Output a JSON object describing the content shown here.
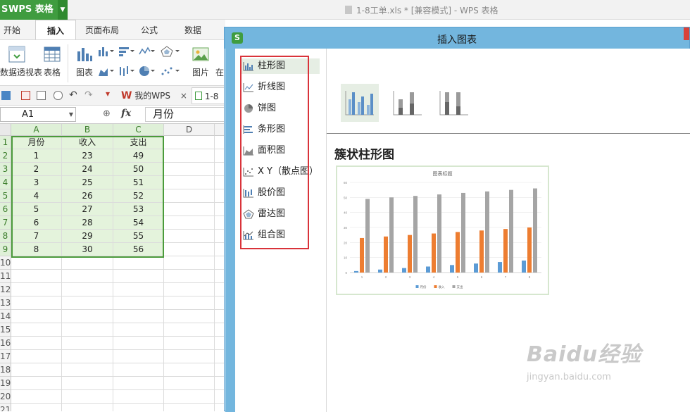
{
  "app": {
    "name": "WPS 表格",
    "logo": "S",
    "window_title": "1-8工单.xls * [兼容模式] - WPS 表格"
  },
  "ribbon": {
    "tabs": [
      "开始",
      "插入",
      "页面布局",
      "公式",
      "数据"
    ],
    "active_tab": "插入",
    "buttons": {
      "pivot": "数据透视表",
      "table": "表格",
      "chart": "图表",
      "picture": "图片",
      "more": "在"
    }
  },
  "quickbar": {
    "wps_tab": "我的WPS",
    "close": "×",
    "doc_tab": "1-8"
  },
  "formula_bar": {
    "cell_ref": "A1",
    "fx": "fx",
    "content": "月份"
  },
  "sheet": {
    "columns": [
      "A",
      "B",
      "C",
      "D"
    ],
    "rows": [
      "1",
      "2",
      "3",
      "4",
      "5",
      "6",
      "7",
      "8",
      "9",
      "10",
      "11",
      "12",
      "13",
      "14",
      "15",
      "16",
      "17",
      "18",
      "19",
      "20",
      "21"
    ],
    "header": [
      "月份",
      "收入",
      "支出"
    ],
    "data": [
      [
        "1",
        "23",
        "49"
      ],
      [
        "2",
        "24",
        "50"
      ],
      [
        "3",
        "25",
        "51"
      ],
      [
        "4",
        "26",
        "52"
      ],
      [
        "5",
        "27",
        "53"
      ],
      [
        "6",
        "28",
        "54"
      ],
      [
        "7",
        "29",
        "55"
      ],
      [
        "8",
        "30",
        "56"
      ]
    ]
  },
  "dialog": {
    "title": "插入图表",
    "icon": "S",
    "chart_types": [
      {
        "label": "柱形图",
        "icon": "column-chart-icon"
      },
      {
        "label": "折线图",
        "icon": "line-chart-icon"
      },
      {
        "label": "饼图",
        "icon": "pie-chart-icon"
      },
      {
        "label": "条形图",
        "icon": "bar-chart-icon"
      },
      {
        "label": "面积图",
        "icon": "area-chart-icon"
      },
      {
        "label": "X Y（散点图）",
        "icon": "scatter-chart-icon"
      },
      {
        "label": "股价图",
        "icon": "stock-chart-icon"
      },
      {
        "label": "雷达图",
        "icon": "radar-chart-icon"
      },
      {
        "label": "组合图",
        "icon": "combo-chart-icon"
      }
    ],
    "selected_type": "柱形图",
    "subtype_heading": "簇状柱形图",
    "preview_title": "图表标题",
    "preview_legend": [
      "月份",
      "收入",
      "支出"
    ],
    "colors": {
      "series1": "#5b9bd5",
      "series2": "#ed7d31",
      "series3": "#a5a5a5"
    }
  },
  "chart_data": {
    "type": "bar",
    "title": "图表标题",
    "categories": [
      "1",
      "2",
      "3",
      "4",
      "5",
      "6",
      "7",
      "8"
    ],
    "series": [
      {
        "name": "月份",
        "values": [
          1,
          2,
          3,
          4,
          5,
          6,
          7,
          8
        ]
      },
      {
        "name": "收入",
        "values": [
          23,
          24,
          25,
          26,
          27,
          28,
          29,
          30
        ]
      },
      {
        "name": "支出",
        "values": [
          49,
          50,
          51,
          52,
          53,
          54,
          55,
          56
        ]
      }
    ],
    "ylim": [
      0,
      60
    ],
    "yticks": [
      0,
      10,
      20,
      30,
      40,
      50,
      60
    ],
    "grid": true,
    "legend": "bottom"
  },
  "watermark": {
    "brand": "Baidu经验",
    "url": "jingyan.baidu.com"
  }
}
